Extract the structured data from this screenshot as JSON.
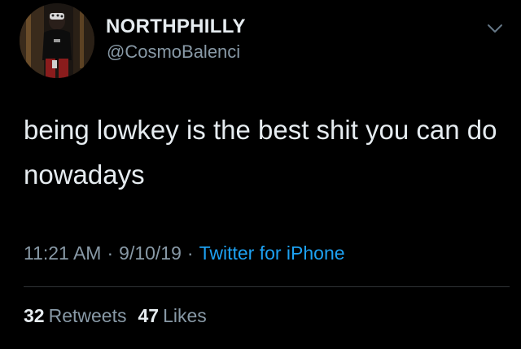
{
  "tweet": {
    "display_name": "NORTHPHILLY",
    "handle": "@CosmoBalenci",
    "text": "being lowkey is the best shit you can do nowadays",
    "time": "11:21 AM",
    "date": "9/10/19",
    "separator": "·",
    "source": "Twitter for iPhone",
    "retweets_count": "32",
    "retweets_label": "Retweets",
    "likes_count": "47",
    "likes_label": "Likes"
  },
  "icons": {
    "menu": "chevron-down-icon",
    "avatar": "profile-photo"
  },
  "colors": {
    "background": "#000000",
    "primary_text": "#e6ecf0",
    "secondary_text": "#8899a6",
    "link": "#1da1f2",
    "divider": "#2f3336"
  }
}
